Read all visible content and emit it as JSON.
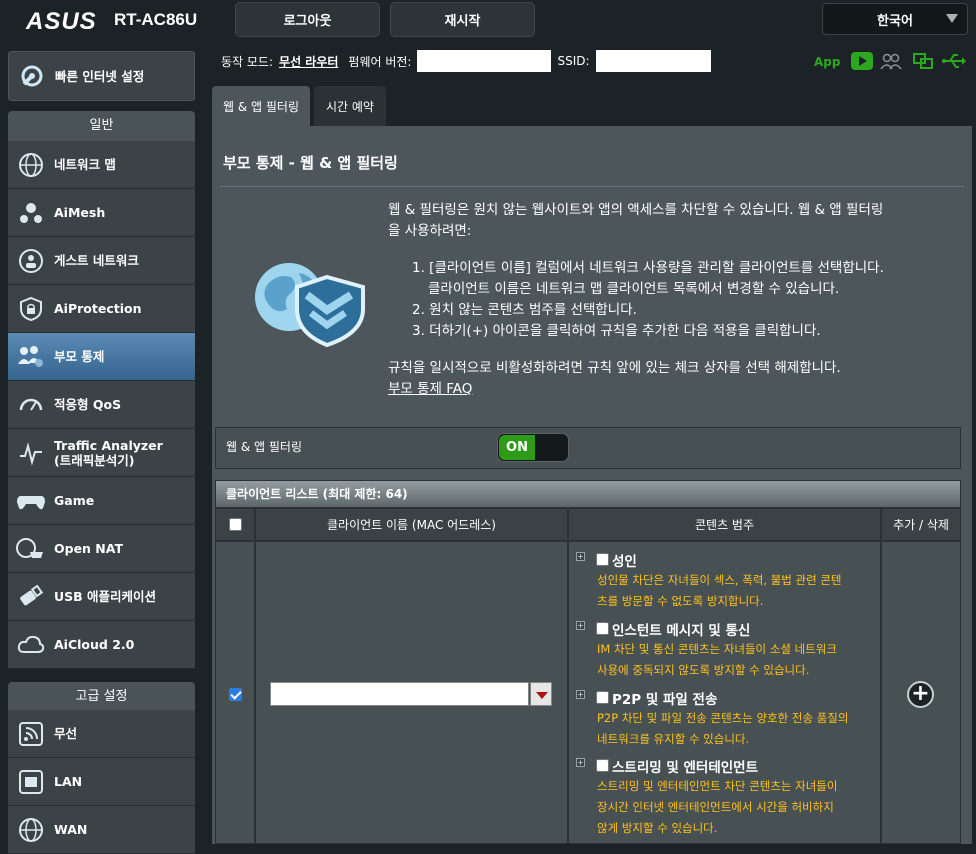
{
  "brand": "ASUS",
  "model": "RT-AC86U",
  "top_buttons": {
    "logout": "로그아웃",
    "reboot": "재시작"
  },
  "language": "한국어",
  "sidebar": {
    "quick_setup": "빠른 인터넷 설정",
    "general_header": "일반",
    "general_items": [
      {
        "label": "네트워크 맵",
        "icon": "globe-icon"
      },
      {
        "label": "AiMesh",
        "icon": "mesh-icon"
      },
      {
        "label": "게스트 네트워크",
        "icon": "guest-network-icon"
      },
      {
        "label": "AiProtection",
        "icon": "lock-shield-icon"
      },
      {
        "label": "부모 통제",
        "icon": "family-icon"
      },
      {
        "label": "적응형 QoS",
        "icon": "gauge-icon"
      },
      {
        "label": "Traffic Analyzer",
        "label2": "(트래픽분석기)",
        "icon": "traffic-icon"
      },
      {
        "label": "Game",
        "icon": "gamepad-icon"
      },
      {
        "label": "Open NAT",
        "icon": "open-nat-icon"
      },
      {
        "label": "USB 애플리케이션",
        "icon": "usb-icon"
      },
      {
        "label": "AiCloud 2.0",
        "icon": "cloud-icon"
      }
    ],
    "advanced_header": "고급 설정",
    "advanced_items": [
      {
        "label": "무선",
        "icon": "wireless-icon"
      },
      {
        "label": "LAN",
        "icon": "lan-icon"
      },
      {
        "label": "WAN",
        "icon": "wan-globe-icon"
      }
    ]
  },
  "status_bar": {
    "mode_label": "동작 모드:",
    "mode_value": "무선 라우터",
    "firmware_label": "펌웨어 버전:",
    "firmware_value": "",
    "ssid_label": "SSID:",
    "ssid_value": "",
    "app_label": "App"
  },
  "tabs": [
    "웹 & 앱 필터링",
    "시간 예약"
  ],
  "page_title": "부모 통제 - 웹 & 앱 필터링",
  "description": {
    "intro_line1": "웹 & 필터링은 원치 않는 웹사이트와 앱의 액세스를 차단할 수 있습니다. 웹 & 앱 필터링",
    "intro_line2": "을 사용하려면:",
    "steps": [
      "1. [클라이언트 이름] 컬럼에서 네트워크 사용량을 관리할 클라이언트를 선택합니다.",
      "클라이언트 이름은 네트워크 맵 클라이언트 목록에서 변경할 수 있습니다.",
      "2. 원치 않는 콘텐츠 범주를 선택합니다.",
      "3. 더하기(+) 아이콘을 클릭하여 규칙을 추가한 다음 적용을 클릭합니다."
    ],
    "note": "규칙을 일시적으로 비활성화하려면 규칙 앞에 있는 체크 상자를 선택 해제합니다.",
    "faq_link": "부모 통제 FAQ"
  },
  "filter_toggle": {
    "label": "웹 & 앱 필터링",
    "state": "ON"
  },
  "client_list": {
    "title": "클라이언트 리스트 (최대 제한: 64)",
    "columns": [
      "클라이언트 이름 (MAC 어드레스)",
      "콘텐츠 범주",
      "추가 / 삭제"
    ],
    "client_value": "",
    "add_symbol": "+",
    "categories": [
      {
        "title": "성인",
        "desc1": "성인물 차단은 자녀들이 섹스, 폭력, 불법 관련 콘텐",
        "desc2": "츠를 방문할 수 없도록 방지합니다."
      },
      {
        "title": "인스턴트 메시지 및 통신",
        "desc1": "IM 차단 및 통신 콘텐츠는 자녀들이 소셜 네트워크",
        "desc2": "사용에 중독되지 않도록 방지할 수 있습니다."
      },
      {
        "title": "P2P 및 파일 전송",
        "desc1": "P2P 차단 및 파일 전송 콘텐츠는 양호한 전송 품질의",
        "desc2": "네트워크를 유지할 수 있습니다."
      },
      {
        "title": "스트리밍 및 엔터테인먼트",
        "desc1": "스트리밍 및 엔터테인먼트 차단 콘텐츠는 자녀들이",
        "desc2": "장시간 인터넷 엔터테인먼트에서 시간을 허비하지",
        "desc3": "않게 방지할 수 있습니다."
      }
    ]
  },
  "colors": {
    "accent_green": "#2ca81e",
    "warning_text": "#ffc21b",
    "active_menu": "#4a7aa3"
  }
}
